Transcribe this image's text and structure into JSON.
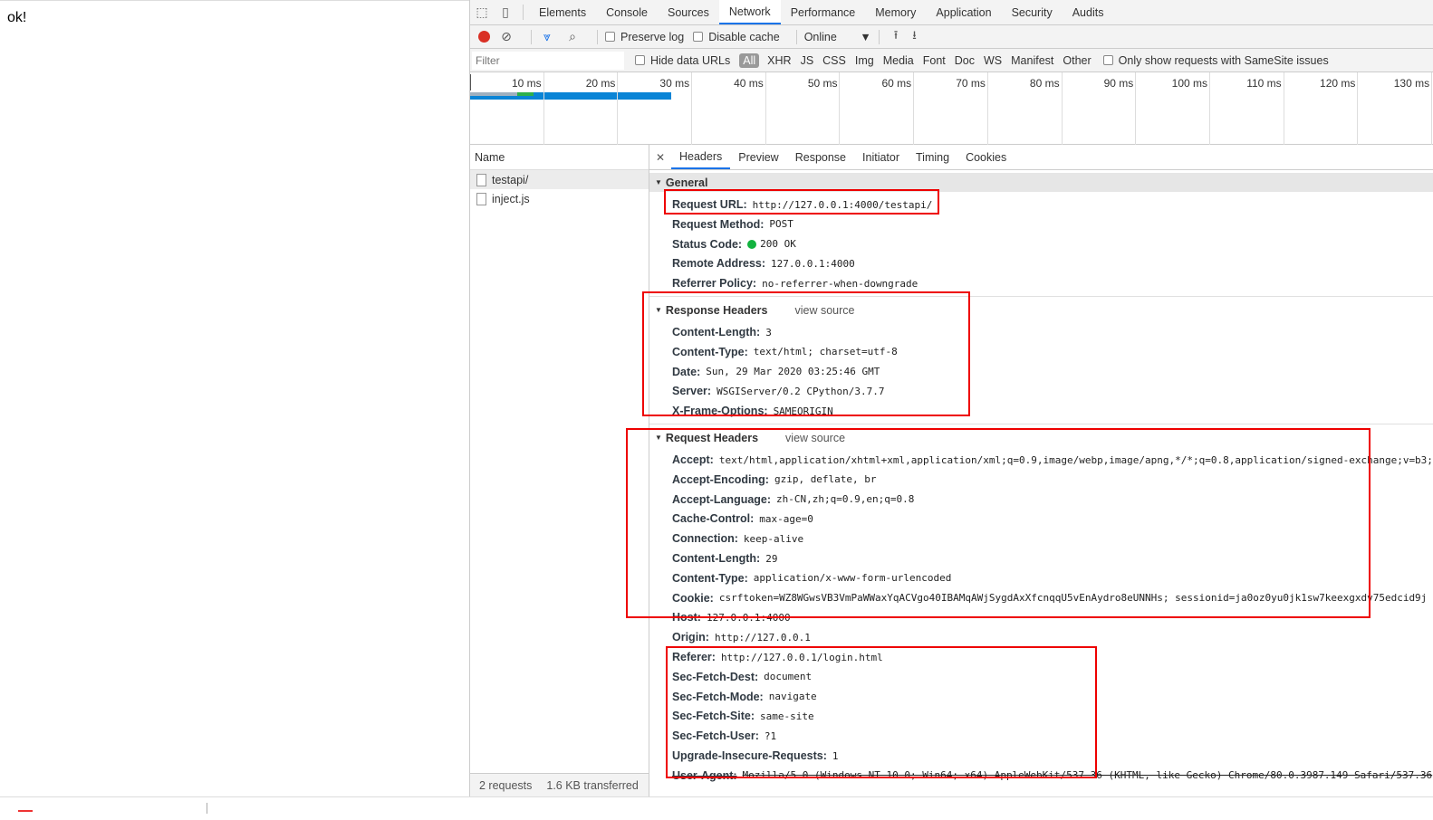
{
  "page": {
    "body_text": "ok!"
  },
  "devtools": {
    "tabs": [
      "Elements",
      "Console",
      "Sources",
      "Network",
      "Performance",
      "Memory",
      "Application",
      "Security",
      "Audits"
    ],
    "active_tab": "Network",
    "toolbar": {
      "preserve_log": "Preserve log",
      "disable_cache": "Disable cache",
      "throttle": "Online"
    },
    "filterbar": {
      "placeholder": "Filter",
      "hide_data_urls": "Hide data URLs",
      "types": [
        "All",
        "XHR",
        "JS",
        "CSS",
        "Img",
        "Media",
        "Font",
        "Doc",
        "WS",
        "Manifest",
        "Other"
      ],
      "samesite": "Only show requests with SameSite issues"
    },
    "timeline_ticks": [
      "10 ms",
      "20 ms",
      "30 ms",
      "40 ms",
      "50 ms",
      "60 ms",
      "70 ms",
      "80 ms",
      "90 ms",
      "100 ms",
      "110 ms",
      "120 ms",
      "130 ms"
    ],
    "requests": {
      "header": "Name",
      "items": [
        "testapi/",
        "inject.js"
      ],
      "footer_count": "2 requests",
      "footer_transferred": "1.6 KB transferred"
    },
    "detail_tabs": [
      "Headers",
      "Preview",
      "Response",
      "Initiator",
      "Timing",
      "Cookies"
    ],
    "general": {
      "title": "General",
      "rows": [
        {
          "k": "Request URL:",
          "v": "http://127.0.0.1:4000/testapi/"
        },
        {
          "k": "Request Method:",
          "v": "POST"
        },
        {
          "k": "Status Code:",
          "v": "200 OK"
        },
        {
          "k": "Remote Address:",
          "v": "127.0.0.1:4000"
        },
        {
          "k": "Referrer Policy:",
          "v": "no-referrer-when-downgrade"
        }
      ]
    },
    "response_headers": {
      "title": "Response Headers",
      "view_source": "view source",
      "rows": [
        {
          "k": "Content-Length:",
          "v": "3"
        },
        {
          "k": "Content-Type:",
          "v": "text/html; charset=utf-8"
        },
        {
          "k": "Date:",
          "v": "Sun, 29 Mar 2020 03:25:46 GMT"
        },
        {
          "k": "Server:",
          "v": "WSGIServer/0.2 CPython/3.7.7"
        },
        {
          "k": "X-Frame-Options:",
          "v": "SAMEORIGIN"
        }
      ]
    },
    "request_headers": {
      "title": "Request Headers",
      "view_source": "view source",
      "rows": [
        {
          "k": "Accept:",
          "v": "text/html,application/xhtml+xml,application/xml;q=0.9,image/webp,image/apng,*/*;q=0.8,application/signed-exchange;v=b3;"
        },
        {
          "k": "Accept-Encoding:",
          "v": "gzip, deflate, br"
        },
        {
          "k": "Accept-Language:",
          "v": "zh-CN,zh;q=0.9,en;q=0.8"
        },
        {
          "k": "Cache-Control:",
          "v": "max-age=0"
        },
        {
          "k": "Connection:",
          "v": "keep-alive"
        },
        {
          "k": "Content-Length:",
          "v": "29"
        },
        {
          "k": "Content-Type:",
          "v": "application/x-www-form-urlencoded"
        },
        {
          "k": "Cookie:",
          "v": "csrftoken=WZ8WGwsVB3VmPaWWaxYqACVgo40IBAMqAWjSygdAxXfcnqqU5vEnAydro8eUNNHs; sessionid=ja0oz0yu0jk1sw7keexgxdv75edcid9j"
        },
        {
          "k": "Host:",
          "v": "127.0.0.1:4000"
        },
        {
          "k": "Origin:",
          "v": "http://127.0.0.1"
        },
        {
          "k": "Referer:",
          "v": "http://127.0.0.1/login.html"
        },
        {
          "k": "Sec-Fetch-Dest:",
          "v": "document"
        },
        {
          "k": "Sec-Fetch-Mode:",
          "v": "navigate"
        },
        {
          "k": "Sec-Fetch-Site:",
          "v": "same-site"
        },
        {
          "k": "Sec-Fetch-User:",
          "v": "?1"
        },
        {
          "k": "Upgrade-Insecure-Requests:",
          "v": "1"
        },
        {
          "k": "User-Agent:",
          "v": "Mozilla/5.0 (Windows NT 10.0; Win64; x64) AppleWebKit/537.36 (KHTML, like Gecko) Chrome/80.0.3987.149 Safari/537.36"
        }
      ]
    },
    "colors": {
      "accent": "#1a73e8",
      "record": "#d93025",
      "status_ok": "#12b23f",
      "annotation": "#e00000"
    }
  }
}
